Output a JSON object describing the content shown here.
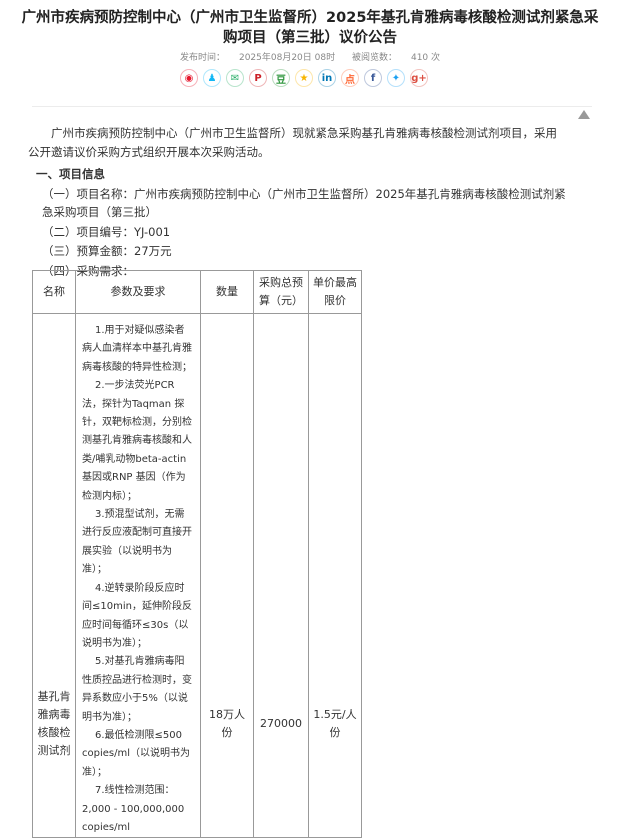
{
  "article": {
    "title": "广州市疾病预防控制中心（广州市卫生监督所）2025年基孔肯雅病毒核酸检测试剂紧急采购项目（第三批）议价公告",
    "publish_label": "发布时间：",
    "publish_time": "2025年08月20日 08时",
    "views_label": "被阅览数：",
    "views": "410 次"
  },
  "share_icons": [
    {
      "name": "weibo-icon",
      "glyph": "◉",
      "color": "#e6162d"
    },
    {
      "name": "qq-icon",
      "glyph": "♟",
      "color": "#12b7f5"
    },
    {
      "name": "wechat-icon",
      "glyph": "✉",
      "color": "#2aae67"
    },
    {
      "name": "pinterest-icon",
      "glyph": "P",
      "color": "#cb2027"
    },
    {
      "name": "douban-icon",
      "glyph": "豆",
      "color": "#2e963d"
    },
    {
      "name": "qzone-icon",
      "glyph": "★",
      "color": "#f8b500"
    },
    {
      "name": "linkedin-icon",
      "glyph": "in",
      "color": "#0077b5"
    },
    {
      "name": "dianping-icon",
      "glyph": "点",
      "color": "#ff6633"
    },
    {
      "name": "facebook-icon",
      "glyph": "f",
      "color": "#3b5998"
    },
    {
      "name": "twitter-icon",
      "glyph": "✦",
      "color": "#1da1f2"
    },
    {
      "name": "googleplus-icon",
      "glyph": "g+",
      "color": "#dc4e41"
    }
  ],
  "content": {
    "intro": "广州市疾病预防控制中心（广州市卫生监督所）现就紧急采购基孔肯雅病毒核酸检测试剂项目，采用公开邀请议价采购方式组织开展本次采购活动。",
    "section1": "一、项目信息",
    "item1": "（一）项目名称：广州市疾病预防控制中心（广州市卫生监督所）2025年基孔肯雅病毒核酸检测试剂紧急采购项目（第三批）",
    "item2": "（二）项目编号：YJ-001",
    "item3": "（三）预算金额：27万元",
    "item4": "（四）采购需求："
  },
  "table": {
    "headers": {
      "name": "名称",
      "spec": "参数及要求",
      "qty": "数量",
      "budget": "采购总预算（元）",
      "price": "单价最高限价"
    },
    "row": {
      "name": "基孔肯雅病毒核酸检测试剂",
      "spec": [
        "1.用于对疑似感染者病人血清样本中基孔肯雅病毒核酸的特异性检测；",
        "2.一步法荧光PCR 法，探针为Taqman 探针，双靶标检测，分别检测基孔肯雅病毒核酸和人类/哺乳动物beta-actin 基因或RNP 基因（作为检测内标）；",
        "3.预混型试剂，无需进行反应液配制可直接开展实验（以说明书为准）；",
        "4.逆转录阶段反应时间≤10min，延伸阶段反应时间每循环≤30s（以说明书为准）；",
        "5.对基孔肯雅病毒阳性质控品进行检测时，变异系数应小于5%（以说明书为准）；",
        "6.最低检测限≤500 copies/ml（以说明书为准）；",
        "7.线性检测范围：2,000 - 100,000,000 copies/ml"
      ],
      "qty": "18万人份",
      "budget": "270000",
      "price": "1.5元/人份"
    }
  }
}
